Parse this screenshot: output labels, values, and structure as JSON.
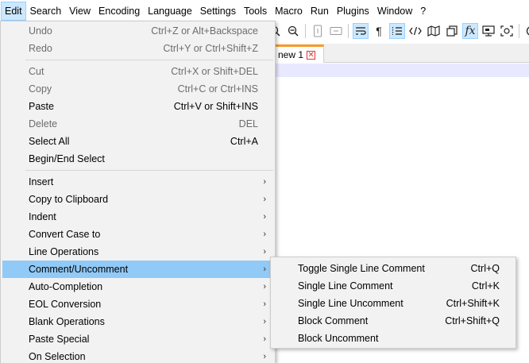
{
  "menubar": {
    "items": [
      "Edit",
      "Search",
      "View",
      "Encoding",
      "Language",
      "Settings",
      "Tools",
      "Macro",
      "Run",
      "Plugins",
      "Window",
      "?"
    ]
  },
  "toolbar": {
    "icons": [
      "zoom-in-icon",
      "zoom-out-icon",
      "sync-vertical-icon",
      "sync-horizontal-icon",
      "word-wrap-icon",
      "show-all-characters-icon",
      "indent-guide-icon",
      "html-tag-icon",
      "document-map-icon",
      "document-list-icon",
      "function-list-icon",
      "folder-workspace-icon",
      "monitoring-icon",
      "record-macro-icon"
    ]
  },
  "tab": {
    "label": "new 1",
    "close_glyph": "✕"
  },
  "edit_menu": {
    "items": [
      {
        "label": "Undo",
        "shortcut": "Ctrl+Z or Alt+Backspace",
        "disabled": true
      },
      {
        "label": "Redo",
        "shortcut": "Ctrl+Y or Ctrl+Shift+Z",
        "disabled": true
      },
      {
        "label": "Cut",
        "shortcut": "Ctrl+X or Shift+DEL",
        "disabled": true
      },
      {
        "label": "Copy",
        "shortcut": "Ctrl+C or Ctrl+INS",
        "disabled": true
      },
      {
        "label": "Paste",
        "shortcut": "Ctrl+V or Shift+INS",
        "disabled": false
      },
      {
        "label": "Delete",
        "shortcut": "DEL",
        "disabled": true
      },
      {
        "label": "Select All",
        "shortcut": "Ctrl+A",
        "disabled": false
      },
      {
        "label": "Begin/End Select",
        "shortcut": "",
        "disabled": false
      },
      {
        "label": "Insert",
        "submenu": true
      },
      {
        "label": "Copy to Clipboard",
        "submenu": true
      },
      {
        "label": "Indent",
        "submenu": true
      },
      {
        "label": "Convert Case to",
        "submenu": true
      },
      {
        "label": "Line Operations",
        "submenu": true
      },
      {
        "label": "Comment/Uncomment",
        "submenu": true,
        "highlight": true
      },
      {
        "label": "Auto-Completion",
        "submenu": true
      },
      {
        "label": "EOL Conversion",
        "submenu": true
      },
      {
        "label": "Blank Operations",
        "submenu": true
      },
      {
        "label": "Paste Special",
        "submenu": true
      },
      {
        "label": "On Selection",
        "submenu": true
      }
    ]
  },
  "comment_submenu": {
    "items": [
      {
        "label": "Toggle Single Line Comment",
        "shortcut": "Ctrl+Q"
      },
      {
        "label": "Single Line Comment",
        "shortcut": "Ctrl+K"
      },
      {
        "label": "Single Line Uncomment",
        "shortcut": "Ctrl+Shift+K"
      },
      {
        "label": "Block Comment",
        "shortcut": "Ctrl+Shift+Q"
      },
      {
        "label": "Block Uncomment",
        "shortcut": ""
      }
    ]
  },
  "arrow_glyph": "›"
}
